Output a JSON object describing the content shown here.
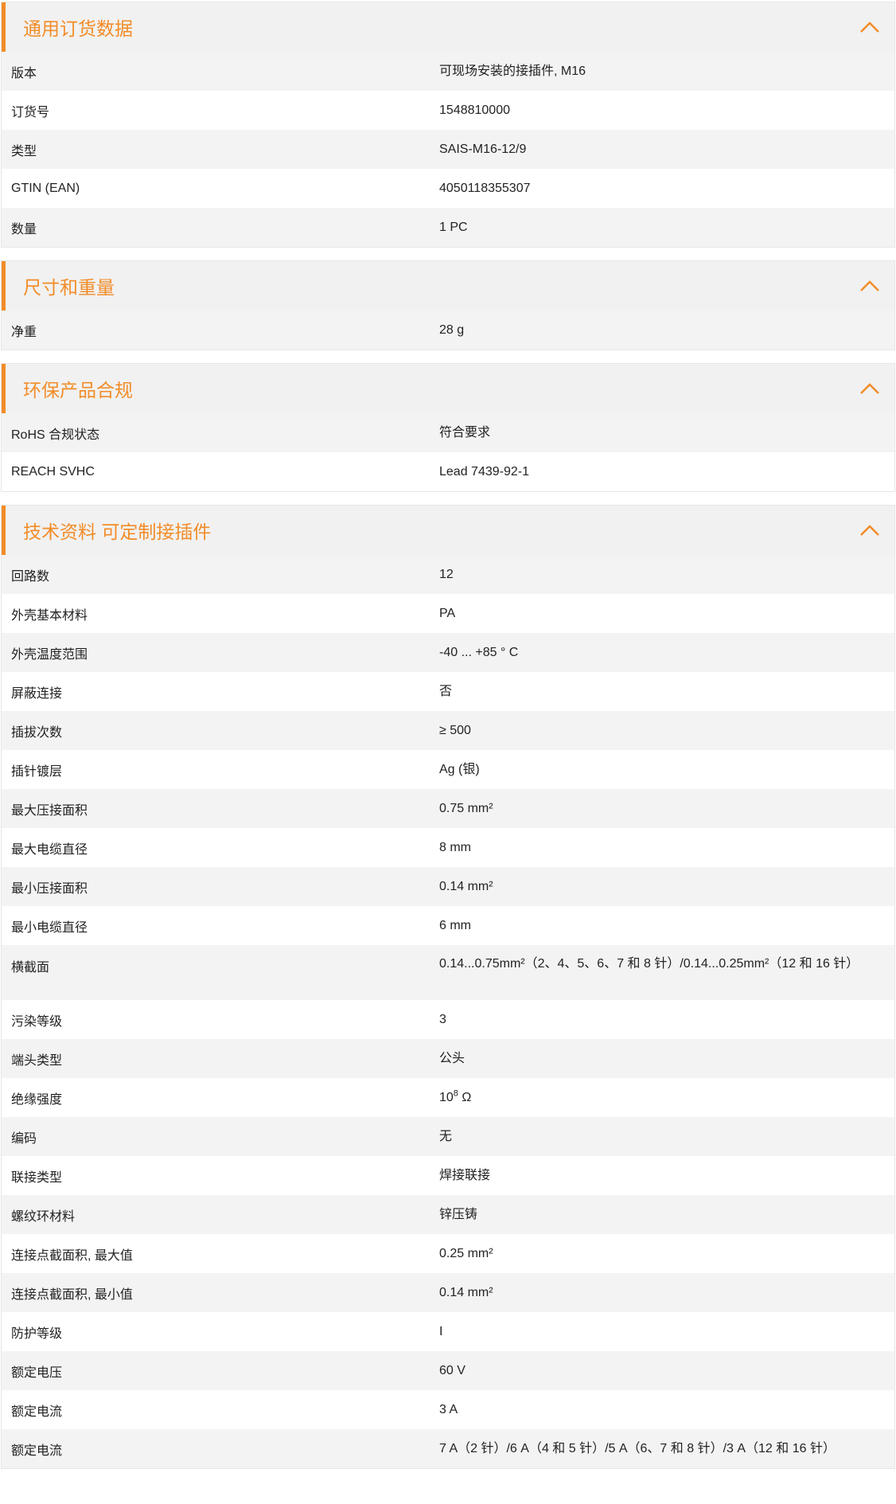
{
  "accent_color": "#f28c28",
  "icons": {
    "collapse": "chevron-up-icon"
  },
  "sections": [
    {
      "title": "通用订货数据",
      "rows": [
        {
          "label": "版本",
          "value": "可现场安装的接插件, M16"
        },
        {
          "label": "订货号",
          "value": "1548810000"
        },
        {
          "label": "类型",
          "value": "SAIS-M16-12/9"
        },
        {
          "label": "GTIN (EAN)",
          "value": "4050118355307"
        },
        {
          "label": "数量",
          "value": "1  PC"
        }
      ]
    },
    {
      "title": "尺寸和重量",
      "rows": [
        {
          "label": "净重",
          "value": "28  g"
        }
      ]
    },
    {
      "title": "环保产品合规",
      "rows": [
        {
          "label": "RoHS 合规状态",
          "value": "符合要求"
        },
        {
          "label": "REACH SVHC",
          "value": "Lead 7439-92-1"
        }
      ]
    },
    {
      "title": "技术资料 可定制接插件",
      "rows": [
        {
          "label": "回路数",
          "value": "12"
        },
        {
          "label": "外壳基本材料",
          "value": "PA"
        },
        {
          "label": "外壳温度范围",
          "value": "-40 ... +85 ° C"
        },
        {
          "label": "屏蔽连接",
          "value": "否"
        },
        {
          "label": "插拔次数",
          "value": "≥ 500"
        },
        {
          "label": "插针镀层",
          "value": "Ag (银)"
        },
        {
          "label": "最大压接面积",
          "value": "0.75  mm²"
        },
        {
          "label": "最大电缆直径",
          "value": "8  mm"
        },
        {
          "label": "最小压接面积",
          "value": "0.14  mm²"
        },
        {
          "label": "最小电缆直径",
          "value": "6  mm"
        },
        {
          "label": "横截面",
          "value": "0.14...0.75mm²（2、4、5、6、7 和 8 针）/0.14...0.25mm²（12 和 16 针）"
        },
        {
          "label": "污染等级",
          "value": "3"
        },
        {
          "label": "端头类型",
          "value": "公头"
        },
        {
          "label": "绝缘强度",
          "value_base": "10",
          "value_sup": "8",
          "value_unit": " Ω"
        },
        {
          "label": "编码",
          "value": "无"
        },
        {
          "label": "联接类型",
          "value": "焊接联接"
        },
        {
          "label": "螺纹环材料",
          "value": "锌压铸"
        },
        {
          "label": "连接点截面积, 最大值",
          "value": "0.25  mm²"
        },
        {
          "label": "连接点截面积, 最小值",
          "value": "0.14  mm²"
        },
        {
          "label": "防护等级",
          "value": "I"
        },
        {
          "label": "额定电压",
          "value": "60  V"
        },
        {
          "label": "额定电流",
          "value": "3  A"
        },
        {
          "label": "额定电流",
          "value": "7 A（2 针）/6 A（4 和 5 针）/5 A（6、7 和 8 针）/3 A（12 和 16 针）"
        }
      ]
    }
  ]
}
